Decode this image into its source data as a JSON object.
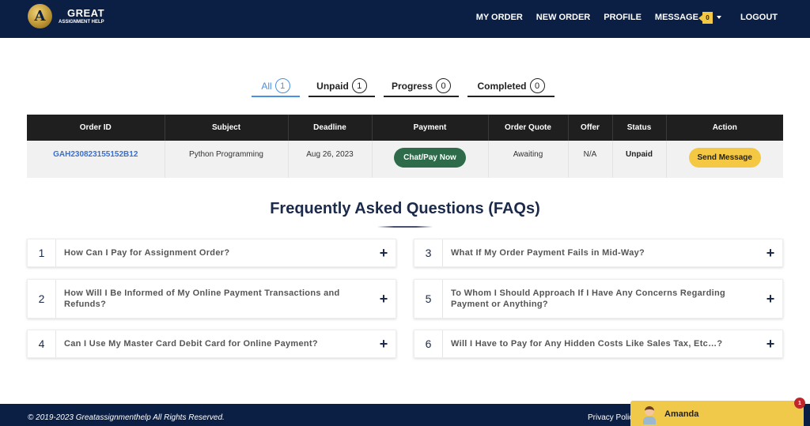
{
  "brand": {
    "line1": "GREAT",
    "line2": "ASSIGNMENT HELP",
    "badge_letter": "A"
  },
  "nav": {
    "my_order": "MY ORDER",
    "new_order": "NEW ORDER",
    "profile": "PROFILE",
    "message": "MESSAGE",
    "message_count": "0",
    "logout": "LOGOUT"
  },
  "tabs": [
    {
      "label": "All",
      "count": "1",
      "active": true
    },
    {
      "label": "Unpaid",
      "count": "1"
    },
    {
      "label": "Progress",
      "count": "0"
    },
    {
      "label": "Completed",
      "count": "0"
    }
  ],
  "table": {
    "headers": [
      "Order ID",
      "Subject",
      "Deadline",
      "Payment",
      "Order Quote",
      "Offer",
      "Status",
      "Action"
    ],
    "rows": [
      {
        "order_id": "GAH230823155152B12",
        "subject": "Python Programming",
        "deadline": "Aug 26, 2023",
        "payment_button": "Chat/Pay Now",
        "order_quote": "Awaiting",
        "offer": "N/A",
        "status": "Unpaid",
        "action_button": "Send Message"
      }
    ]
  },
  "faq": {
    "title": "Frequently Asked Questions (FAQs)",
    "items": [
      {
        "num": "1",
        "question": "How Can I Pay for Assignment Order?"
      },
      {
        "num": "2",
        "question": "How Will I Be Informed of My Online Payment Transactions and Refunds?"
      },
      {
        "num": "4",
        "question": "Can I Use My Master Card Debit Card for Online Payment?"
      },
      {
        "num": "3",
        "question": "What If My Order Payment Fails in Mid-Way?"
      },
      {
        "num": "5",
        "question": "To Whom I Should Approach If I Have Any Concerns Regarding Payment or Anything?"
      },
      {
        "num": "6",
        "question": "Will I Have to Pay for Any Hidden Costs Like Sales Tax, Etc…?"
      }
    ],
    "expand_icon": "+"
  },
  "footer": {
    "copyright": "© 2019-2023 Greatassignmenthelp All Rights Reserved.",
    "privacy": "Privacy Polic"
  },
  "chat": {
    "agent_name": "Amanda",
    "unread": "1"
  },
  "colors": {
    "navy": "#0b1f45",
    "accent_blue": "#4a90e2",
    "pay_green": "#2e6b4a",
    "yellow": "#f4c842"
  }
}
